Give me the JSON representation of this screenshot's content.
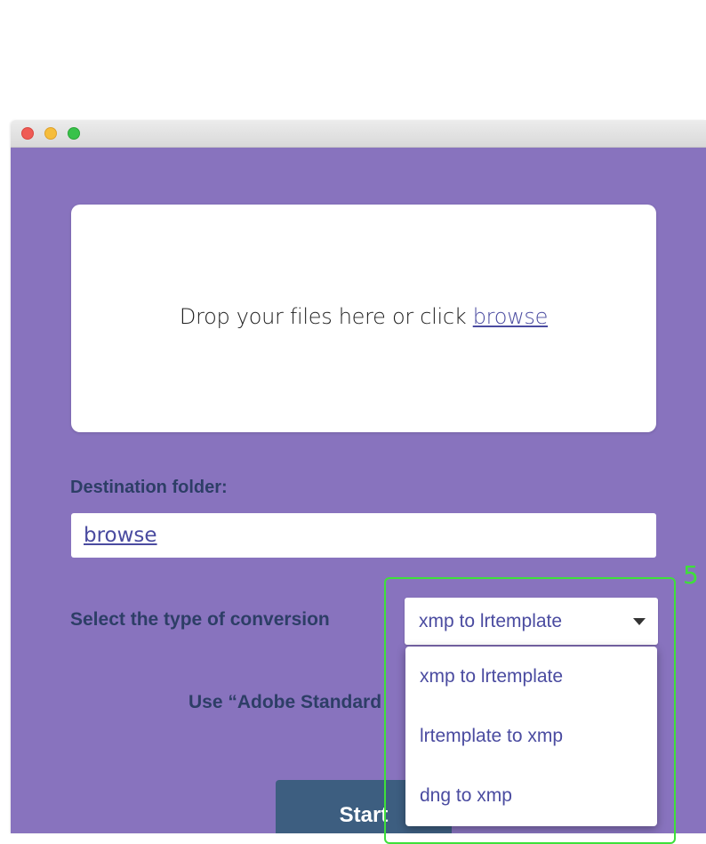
{
  "dropzone": {
    "text": "Drop your files here or click ",
    "browse_link": "browse"
  },
  "destination": {
    "label": "Destination folder:",
    "browse_link": "browse"
  },
  "conversion": {
    "label": "Select the type of conversion",
    "selected": "xmp to lrtemplate",
    "options": [
      "xmp to lrtemplate",
      "lrtemplate to xmp",
      "dng to xmp"
    ]
  },
  "adobe_standard": {
    "label": "Use “Adobe Standard"
  },
  "start_button": {
    "label": "Start"
  },
  "annotation": {
    "number": "5",
    "color": "#3ee03a"
  },
  "colors": {
    "background": "#8873be",
    "accent_text": "#2d3e66",
    "link": "#4a4ba0",
    "button": "#3d5e80"
  }
}
